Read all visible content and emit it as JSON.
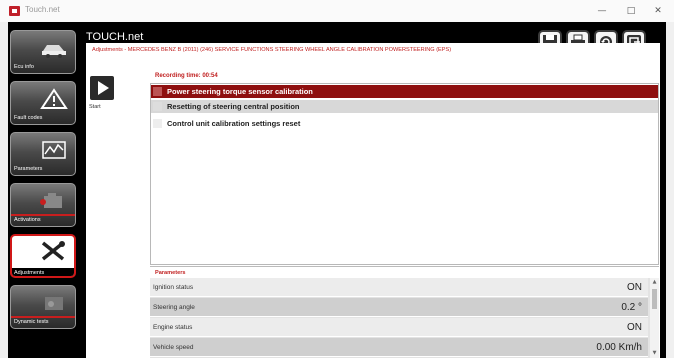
{
  "window": {
    "title": "Touch.net",
    "minimize": "—",
    "restore": "□",
    "close": "✕"
  },
  "header": {
    "app_title": "TOUCH.net",
    "breadcrumb": "Adjustments - MERCEDES BENZ B (2011) (246) SERVICE FUNCTIONS STEERING WHEEL ANGLE CALIBRATION POWERSTEERING (EPS)"
  },
  "toolbar": {
    "buttons": [
      {
        "icon": "save-icon"
      },
      {
        "icon": "print-icon"
      },
      {
        "icon": "refresh-icon"
      },
      {
        "icon": "exit-icon"
      }
    ]
  },
  "sidebar": {
    "items": [
      {
        "label": "Ecu info",
        "icon": "car-info-icon",
        "active": false
      },
      {
        "label": "Fault codes",
        "icon": "warning-icon",
        "active": false
      },
      {
        "label": "Parameters",
        "icon": "graph-icon",
        "active": false
      },
      {
        "label": "Activations",
        "icon": "engine-icon",
        "active": false
      },
      {
        "label": "Adjustments",
        "icon": "tools-icon",
        "active": true
      },
      {
        "label": "Dynamic tests",
        "icon": "dynamic-test-icon",
        "active": false
      }
    ]
  },
  "main": {
    "start_label": "Start",
    "recording_time": "Recording time: 00:54",
    "procedures": [
      {
        "label": "Power steering torque sensor calibration",
        "selected": true
      },
      {
        "label": "Resetting of steering central position",
        "selected": false
      },
      {
        "label": "Control unit calibration settings reset",
        "selected": false
      }
    ]
  },
  "parameters": {
    "title": "Parameters",
    "rows": [
      {
        "name": "Ignition status",
        "value": "ON"
      },
      {
        "name": "Steering angle",
        "value": "0.2 °"
      },
      {
        "name": "Engine status",
        "value": "ON"
      },
      {
        "name": "Vehicle speed",
        "value": "0.00 Km/h"
      }
    ]
  },
  "colors": {
    "accent_red": "#c01f1f",
    "selected_row": "#8e0f0f"
  }
}
